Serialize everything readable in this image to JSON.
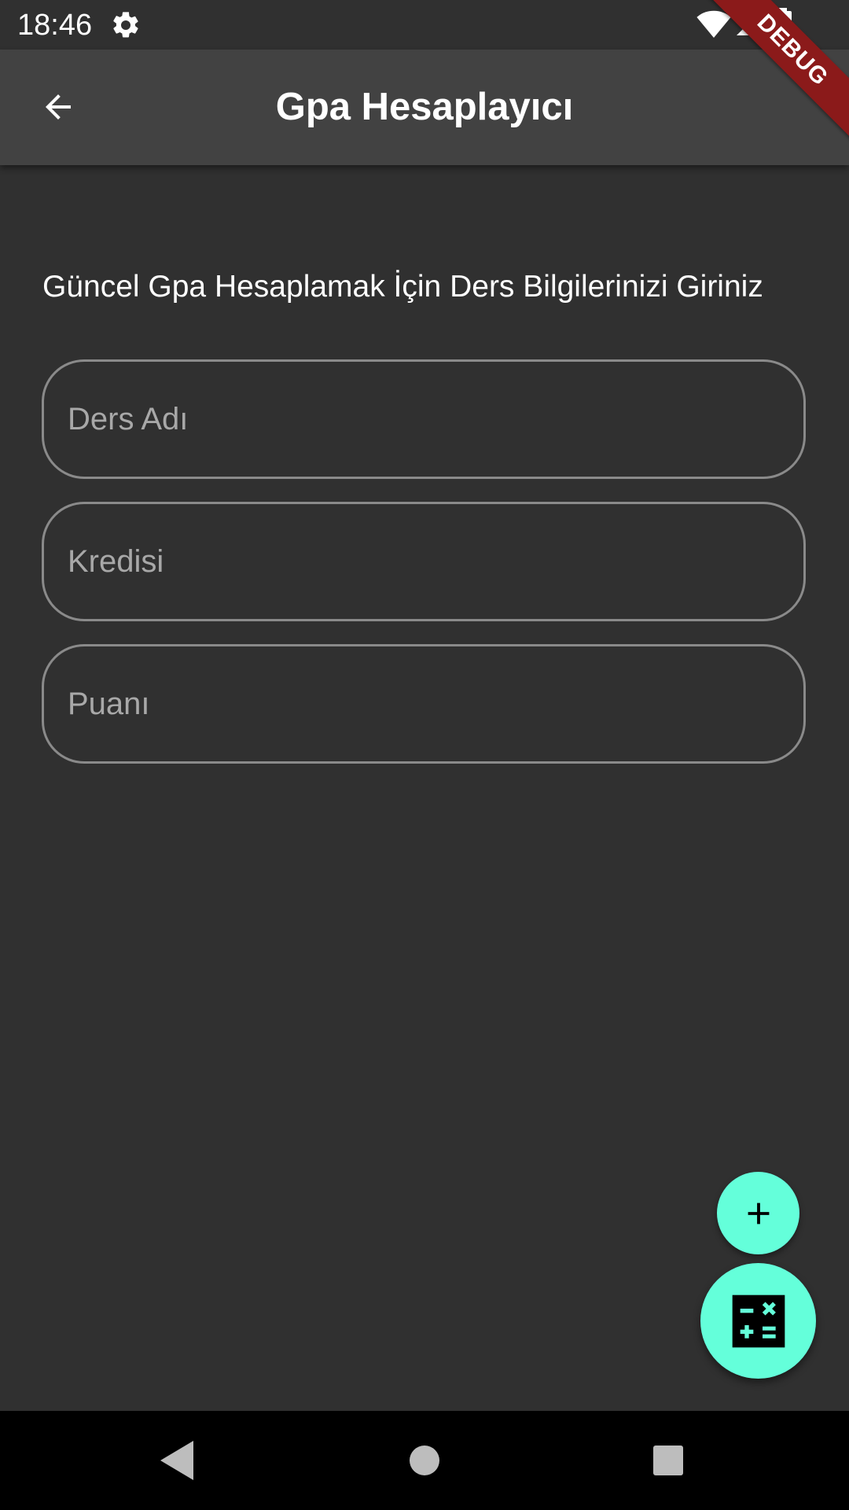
{
  "status_bar": {
    "time": "18:46",
    "icons": [
      "settings-gear-icon",
      "wifi-icon",
      "cell-signal-icon",
      "battery-icon"
    ]
  },
  "app_bar": {
    "title": "Gpa Hesaplayıcı",
    "back_icon": "arrow-left-icon"
  },
  "debug_banner": {
    "label": "DEBUG",
    "color": "#8b1a1a"
  },
  "form": {
    "instruction": "Güncel Gpa Hesaplamak İçin Ders Bilgilerinizi Giriniz",
    "fields": [
      {
        "placeholder": "Ders Adı",
        "value": ""
      },
      {
        "placeholder": "Kredisi",
        "value": ""
      },
      {
        "placeholder": "Puanı",
        "value": ""
      }
    ]
  },
  "fabs": {
    "add_icon": "plus-icon",
    "calculate_icon": "calculator-icon",
    "accent_color": "#64ffda"
  },
  "nav_bar": {
    "icons": [
      "nav-back-triangle-icon",
      "nav-home-circle-icon",
      "nav-recents-square-icon"
    ]
  },
  "theme": {
    "background": "#303030",
    "app_bar": "#424242",
    "field_border": "#8a8a8a"
  }
}
